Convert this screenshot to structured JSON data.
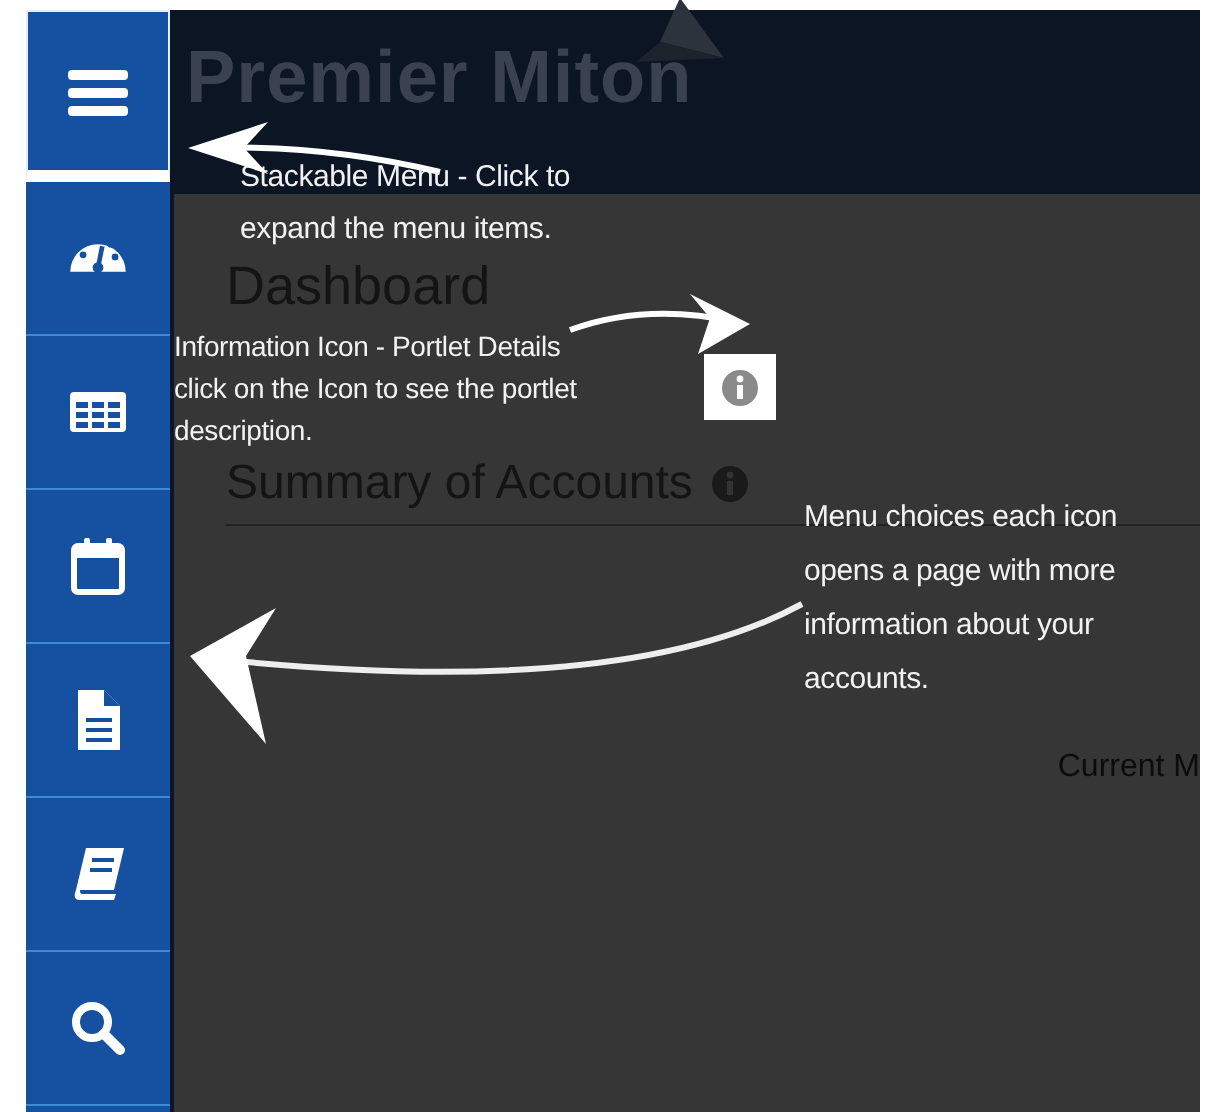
{
  "sidebar": {
    "items": [
      {
        "kind": "menu"
      },
      {
        "kind": "gauge"
      },
      {
        "kind": "table"
      },
      {
        "kind": "calendar"
      },
      {
        "kind": "document"
      },
      {
        "kind": "book"
      },
      {
        "kind": "search"
      }
    ]
  },
  "header": {
    "logo": "Premier Miton"
  },
  "page": {
    "title": "Dashboard",
    "portlet": {
      "title": "Summary of Accounts"
    },
    "column_1": "Current M"
  },
  "annotations": [
    {
      "lines": [
        "Stackable Menu - Click to",
        "expand the menu items."
      ]
    },
    {
      "lines": [
        "Information Icon - Portlet Details",
        "click on the Icon to see the portlet",
        "description."
      ]
    },
    {
      "lines": [
        "Menu choices each icon",
        "opens a page with more",
        "information about your",
        "accounts."
      ]
    }
  ]
}
